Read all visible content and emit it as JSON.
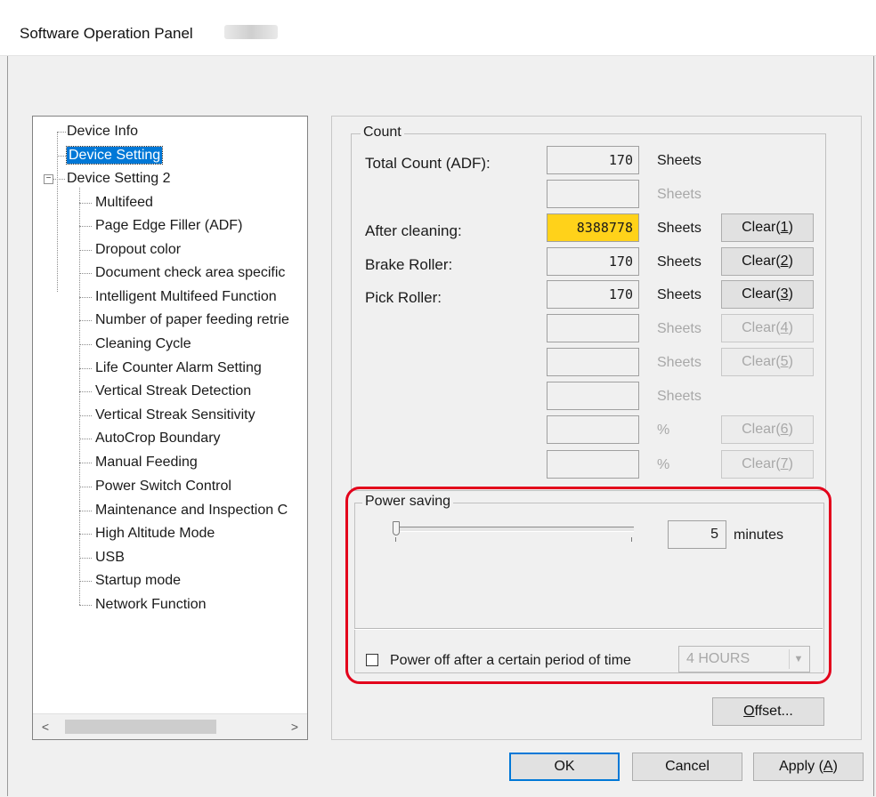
{
  "window": {
    "title": "Software Operation Panel"
  },
  "tree": {
    "items": [
      {
        "label": "Device Info"
      },
      {
        "label": "Device Setting"
      },
      {
        "label": "Device Setting 2"
      },
      {
        "label": "Multifeed"
      },
      {
        "label": "Page Edge Filler (ADF)"
      },
      {
        "label": "Dropout color"
      },
      {
        "label": "Document check area specific"
      },
      {
        "label": "Intelligent Multifeed Function"
      },
      {
        "label": "Number of paper feeding retrie"
      },
      {
        "label": "Cleaning Cycle"
      },
      {
        "label": "Life Counter Alarm Setting"
      },
      {
        "label": "Vertical Streak Detection"
      },
      {
        "label": "Vertical Streak Sensitivity"
      },
      {
        "label": "AutoCrop Boundary"
      },
      {
        "label": "Manual Feeding"
      },
      {
        "label": "Power Switch Control"
      },
      {
        "label": "Maintenance and Inspection C"
      },
      {
        "label": "High Altitude Mode"
      },
      {
        "label": "USB"
      },
      {
        "label": "Startup mode"
      },
      {
        "label": "Network Function"
      }
    ],
    "selected": "Device Setting",
    "scroll_left": "<",
    "scroll_right": ">"
  },
  "count": {
    "legend": "Count",
    "rows": [
      {
        "label": "Total Count (ADF):",
        "value": "170",
        "unit": "Sheets"
      },
      {
        "label": "",
        "value": "",
        "unit": "Sheets"
      },
      {
        "label": "After cleaning:",
        "value": "8388778",
        "unit": "Sheets",
        "button_text": "Clear",
        "button_key": "1"
      },
      {
        "label": "Brake Roller:",
        "value": "170",
        "unit": "Sheets",
        "button_text": "Clear",
        "button_key": "2"
      },
      {
        "label": "Pick Roller:",
        "value": "170",
        "unit": "Sheets",
        "button_text": "Clear",
        "button_key": "3"
      },
      {
        "label": "",
        "value": "",
        "unit": "Sheets",
        "button_text": "Clear",
        "button_key": "4"
      },
      {
        "label": "",
        "value": "",
        "unit": "Sheets",
        "button_text": "Clear",
        "button_key": "5"
      },
      {
        "label": "",
        "value": "",
        "unit": "Sheets"
      },
      {
        "label": "",
        "value": "",
        "unit": "%",
        "button_text": "Clear",
        "button_key": "6"
      },
      {
        "label": "",
        "value": "",
        "unit": "%",
        "button_text": "Clear",
        "button_key": "7"
      }
    ]
  },
  "power_saving": {
    "legend": "Power saving",
    "value": "5",
    "unit": "minutes",
    "slider_level": 0,
    "power_off_label": "Power off after a certain period of time",
    "power_off_checked": false,
    "power_off_period": "4 HOURS"
  },
  "buttons": {
    "offset_key": "O",
    "offset_text": "ffset...",
    "ok": "OK",
    "cancel": "Cancel",
    "apply_text": "Apply (",
    "apply_key": "A",
    "apply_close": ")"
  },
  "colors": {
    "highlight": "#ffd21a",
    "selection": "#0078d7",
    "callout": "#e3001b"
  }
}
